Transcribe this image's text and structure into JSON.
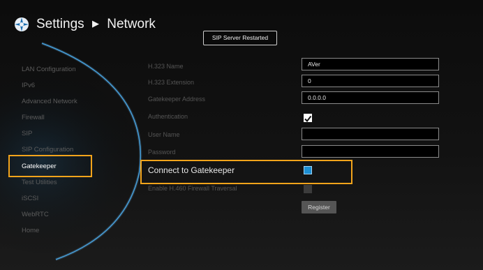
{
  "header": {
    "title": "Settings",
    "subtitle": "Network"
  },
  "status": {
    "badge": "SIP Server Restarted"
  },
  "sidebar": {
    "items": [
      {
        "label": "LAN Configuration",
        "active": false
      },
      {
        "label": "IPv6",
        "active": false
      },
      {
        "label": "Advanced Network",
        "active": false
      },
      {
        "label": "Firewall",
        "active": false
      },
      {
        "label": "SIP",
        "active": false
      },
      {
        "label": "SIP Configuration",
        "active": false
      },
      {
        "label": "Gatekeeper",
        "active": true
      },
      {
        "label": "Test Utilities",
        "active": false
      },
      {
        "label": "iSCSI",
        "active": false
      },
      {
        "label": "WebRTC",
        "active": false
      },
      {
        "label": "Home",
        "active": false
      }
    ]
  },
  "form": {
    "h323_name": {
      "label": "H.323 Name",
      "value": "AVer"
    },
    "h323_extension": {
      "label": "H.323 Extension",
      "value": "0"
    },
    "gatekeeper_address": {
      "label": "Gatekeeper Address",
      "value": "0.0.0.0"
    },
    "authentication": {
      "label": "Authentication",
      "checked": true
    },
    "user_name": {
      "label": "User Name",
      "value": ""
    },
    "password": {
      "label": "Password",
      "value": ""
    },
    "connect_gatekeeper": {
      "label": "Connect to Gatekeeper",
      "checked": true
    },
    "h460": {
      "label": "Enable H.460 Firewall Traversal",
      "checked": false,
      "disabled": true
    },
    "register_label": "Register"
  },
  "colors": {
    "highlight": "#f3a41b",
    "accent_blue": "#1d8fd2",
    "glow": "#3fa3e6"
  },
  "icons": {
    "logo": "settings-logo-icon",
    "arrow": "right-triangle-arrow",
    "check": "checkmark-icon"
  }
}
